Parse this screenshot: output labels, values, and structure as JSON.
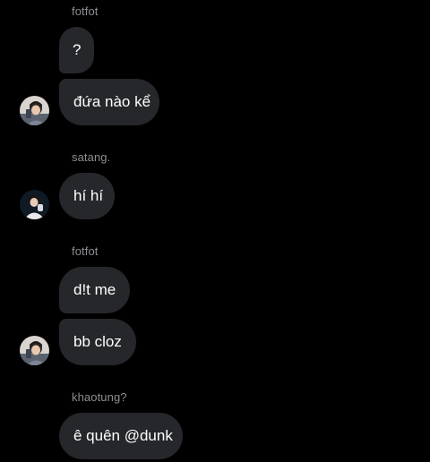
{
  "conversation": {
    "groups": [
      {
        "sender": "fotfot",
        "avatar_icon": "user-avatar-photo-icon",
        "messages": [
          "?",
          "đứa nào kể"
        ]
      },
      {
        "sender": "satang.",
        "avatar_icon": "user-avatar-photo-icon",
        "messages": [
          "hí hí"
        ]
      },
      {
        "sender": "fotfot",
        "avatar_icon": "user-avatar-photo-icon",
        "messages": [
          "d!t me",
          "bb cloz"
        ]
      },
      {
        "sender": "khaotung?",
        "messages": [
          "ê quên @dunk"
        ]
      }
    ]
  },
  "colors": {
    "background": "#000000",
    "bubble": "#26272b",
    "sender_text": "#8e8e93",
    "message_text": "#ffffff"
  }
}
